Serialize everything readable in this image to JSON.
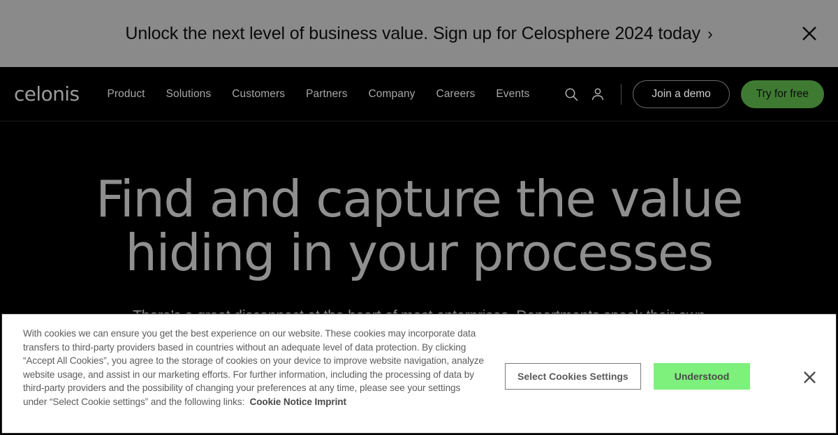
{
  "promo_banner": {
    "message": "Unlock the next level of business value. Sign up for Celosphere 2024 today",
    "chevron": "›",
    "close_icon": "close-icon",
    "background_color": "#8a8a8a",
    "text_color": "#0a0a0a"
  },
  "navbar": {
    "logo": "celonis",
    "links": [
      {
        "label": "Product"
      },
      {
        "label": "Solutions"
      },
      {
        "label": "Customers"
      },
      {
        "label": "Partners"
      },
      {
        "label": "Company"
      },
      {
        "label": "Careers"
      },
      {
        "label": "Events"
      }
    ],
    "search_icon": "search-icon",
    "account_icon": "account-icon",
    "demo_button": "Join a demo",
    "try_button": "Try for free",
    "try_button_color": "#3f7a32"
  },
  "hero": {
    "title": "Find and capture the value hiding in your processes",
    "subtitle": "There’s a great disconnect at the heart of most enterprises. Departments speak their own languages,"
  },
  "cookie_banner": {
    "body": "With cookies we can ensure you get the best experience on our website. These cookies may incorporate data transfers to third-party providers based in countries without an adequate level of data protection. By clicking “Accept All Cookies”, you agree to the storage of cookies on your device to improve website navigation, analyze website usage, and assist in our marketing efforts. For further information, including the processing of data by third-party providers and the possibility of changing your preferences at any time, please see your settings under “Select Cookie settings” and the following links:  ",
    "link_cookie_notice": "Cookie Notice",
    "link_imprint": "Imprint",
    "settings_button": "Select Cookies Settings",
    "accept_button": "Understood",
    "accept_button_color": "#7ef07c",
    "close_icon": "close-icon"
  }
}
